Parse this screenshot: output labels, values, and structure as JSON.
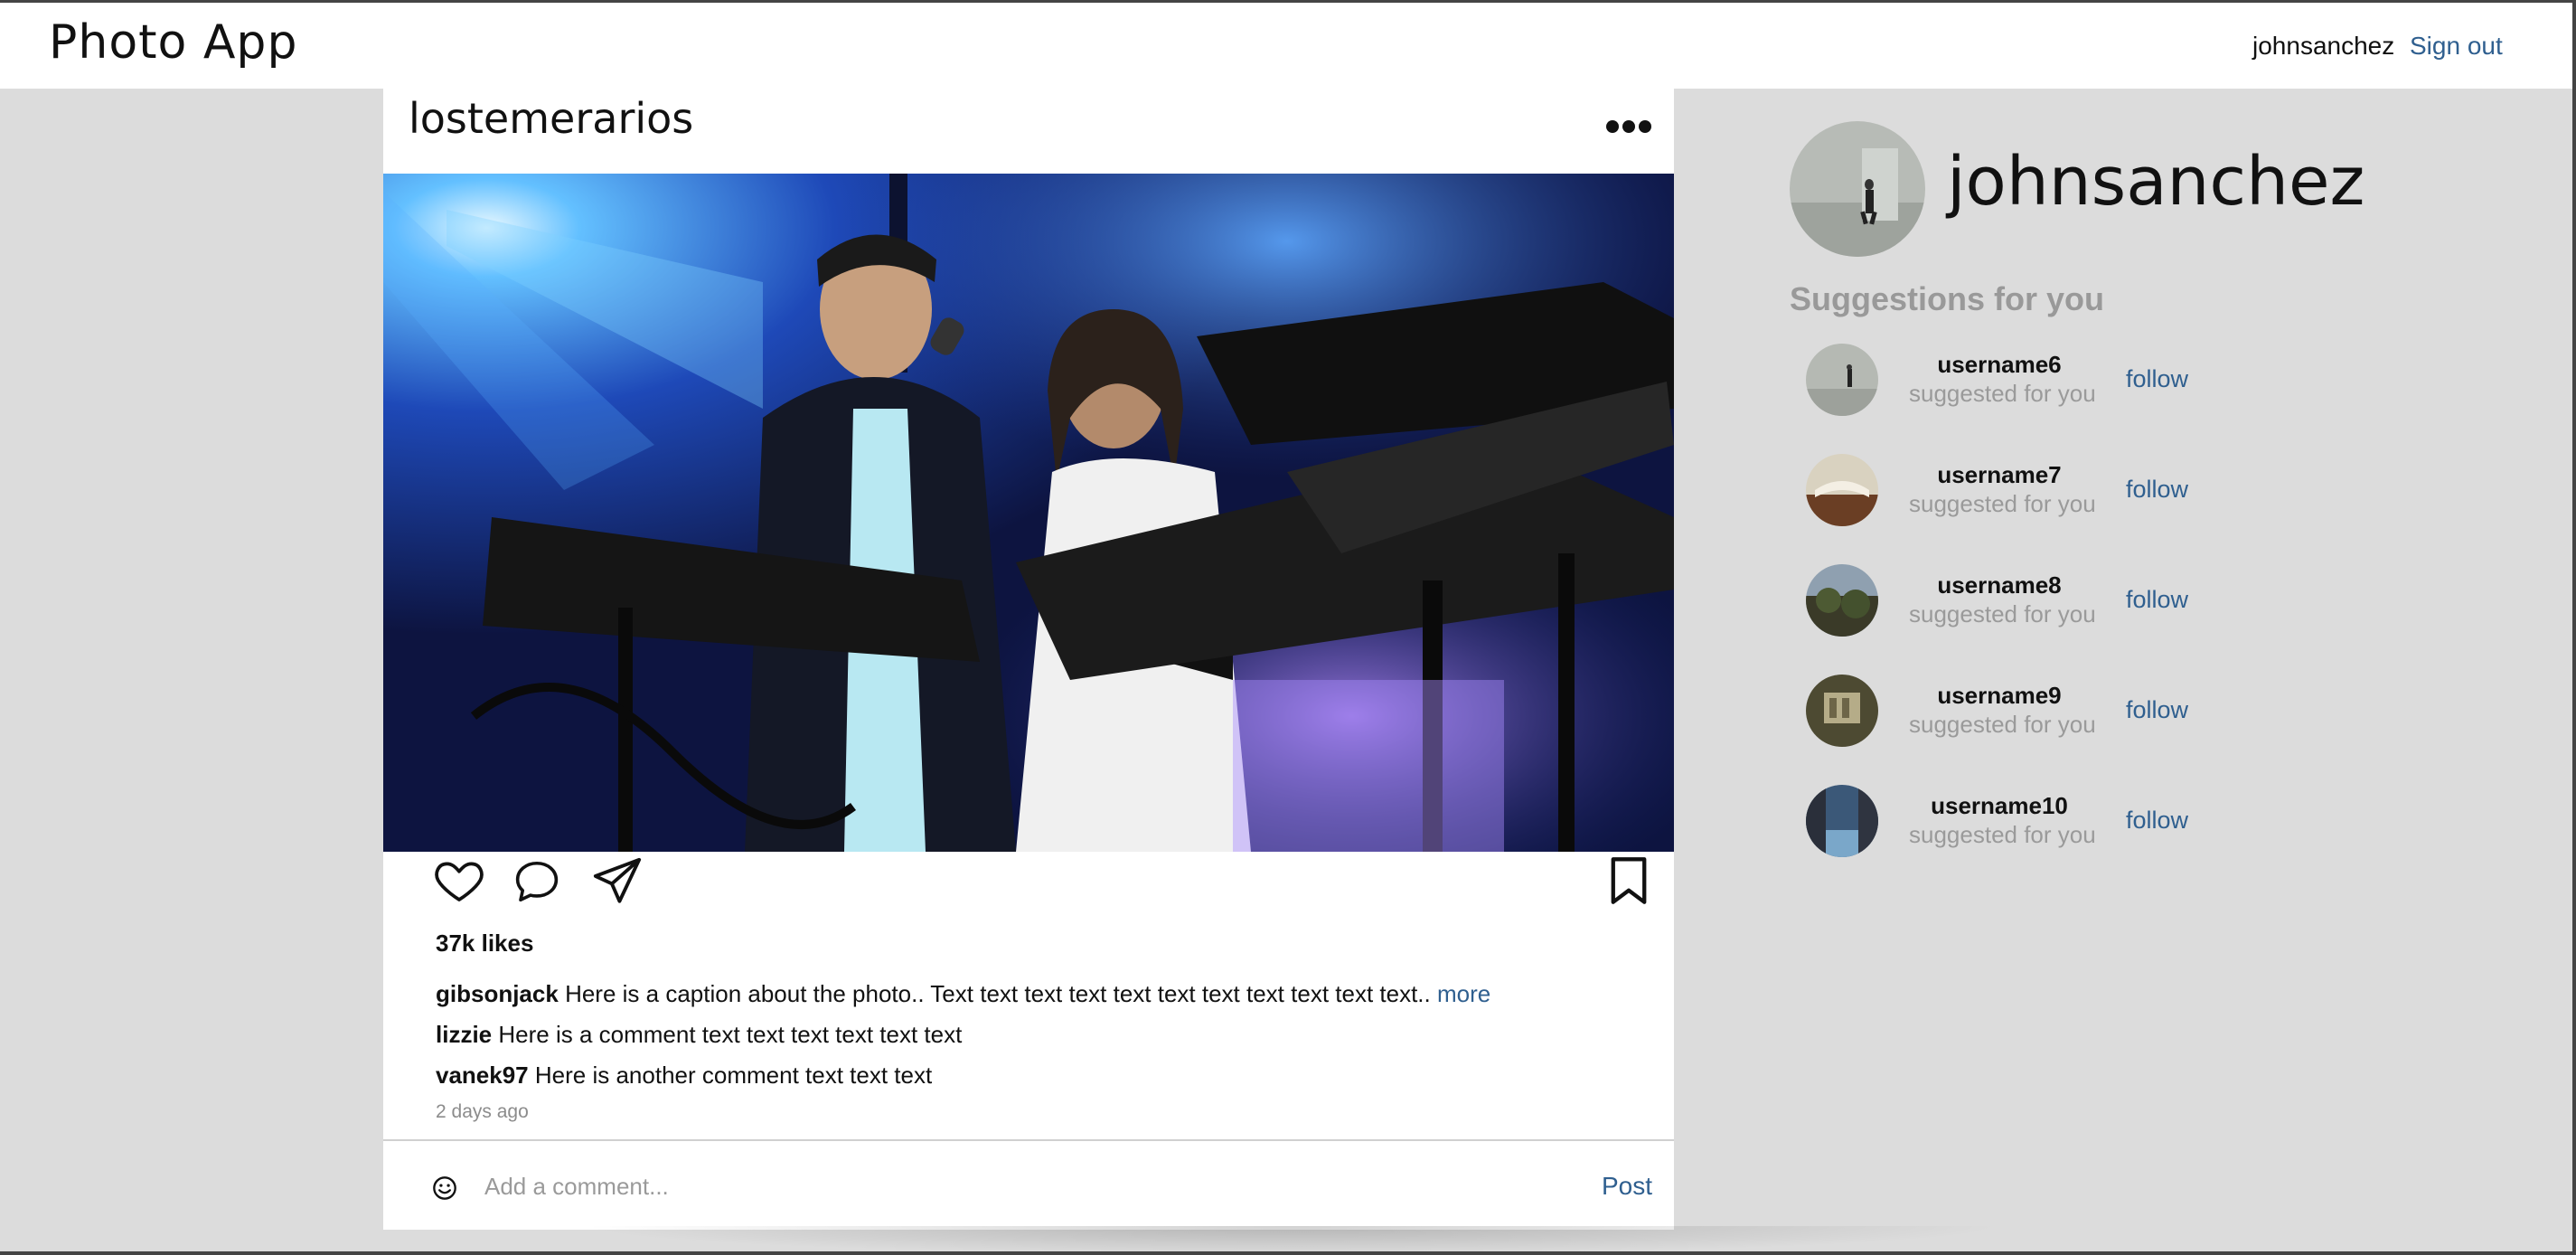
{
  "nav": {
    "brand": "Photo App",
    "username": "johnsanchez",
    "signout_label": "Sign out"
  },
  "post": {
    "username": "lostemerarios",
    "image_description_icon": "concert-photo",
    "likes": "37k likes",
    "caption": {
      "user": "gibsonjack",
      "text": "Here is a caption about the photo.. Text text text text text text text text text text text..",
      "more_label": "more"
    },
    "comments": [
      {
        "user": "lizzie",
        "text": "Here is a comment text text text text text text"
      },
      {
        "user": "vanek97",
        "text": "Here is another comment text text text"
      }
    ],
    "timestamp": "2 days ago",
    "comment_placeholder": "Add a comment...",
    "post_label": "Post"
  },
  "profile": {
    "username": "johnsanchez"
  },
  "suggestions": {
    "title": "Suggestions for you",
    "items": [
      {
        "username": "username6",
        "subtitle": "suggested for you",
        "follow_label": "follow"
      },
      {
        "username": "username7",
        "subtitle": "suggested for you",
        "follow_label": "follow"
      },
      {
        "username": "username8",
        "subtitle": "suggested for you",
        "follow_label": "follow"
      },
      {
        "username": "username9",
        "subtitle": "suggested for you",
        "follow_label": "follow"
      },
      {
        "username": "username10",
        "subtitle": "suggested for you",
        "follow_label": "follow"
      }
    ]
  },
  "colors": {
    "link": "#2f5f8f",
    "background": "#dcdcdc",
    "muted": "#9a9a9a"
  }
}
